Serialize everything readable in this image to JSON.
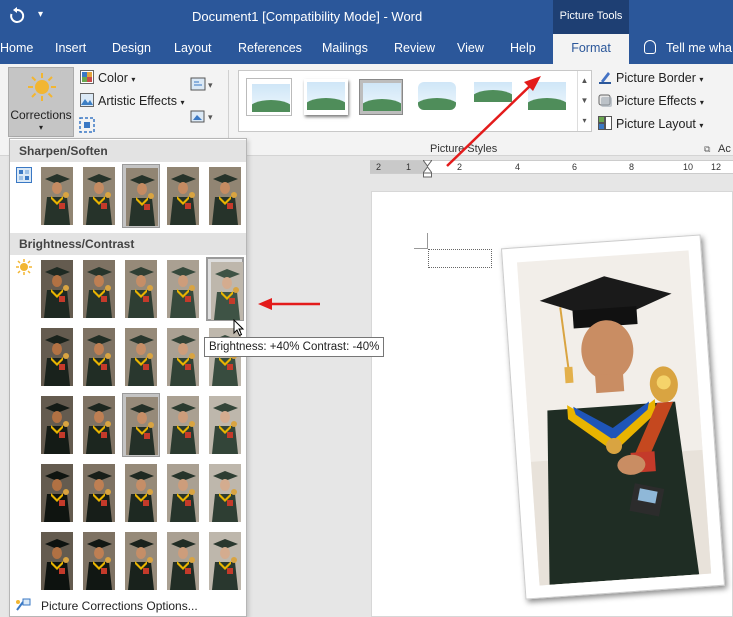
{
  "titlebar": {
    "quick_access_more": "▾",
    "document_title": "Document1 [Compatibility Mode]  -  Word",
    "contextual_tab_group": "Picture Tools"
  },
  "tabs": [
    {
      "label": "Home"
    },
    {
      "label": "Insert"
    },
    {
      "label": "Design"
    },
    {
      "label": "Layout"
    },
    {
      "label": "References"
    },
    {
      "label": "Mailings"
    },
    {
      "label": "Review"
    },
    {
      "label": "View"
    },
    {
      "label": "Help"
    },
    {
      "label": "Format",
      "active": true
    }
  ],
  "tell_me": "Tell me wha",
  "ribbon": {
    "corrections_label": "Corrections",
    "dropdown_caret": "▾",
    "color_label": "Color",
    "artistic_effects_label": "Artistic Effects",
    "picture_border_label": "Picture Border",
    "picture_effects_label": "Picture Effects",
    "picture_layout_label": "Picture Layout",
    "picture_styles_group": "Picture Styles",
    "next_group_label": "Ac",
    "dialog_launcher": "⧉"
  },
  "ruler": {
    "numbers": [
      "2",
      "1",
      "2",
      "4",
      "6",
      "8",
      "10",
      "12"
    ]
  },
  "gallery": {
    "sharpen_header": "Sharpen/Soften",
    "brightness_header": "Brightness/Contrast",
    "options_label": "Picture Corrections Options...",
    "sharpen_selected_index": 2,
    "brightness_selected_row": 2,
    "brightness_selected_col": 2,
    "hover_row": 0,
    "hover_col": 4
  },
  "tooltip": "Brightness: +40% Contrast: -40%",
  "colors": {
    "title_bar": "#2b579a",
    "context_tab": "#1e3f73",
    "ribbon_bg": "#f3f3f3",
    "arrow_red": "#e31b1b",
    "gown": "#1f2d24",
    "trophy_gold": "#d9a441"
  },
  "icons": [
    "undo-icon",
    "sun-icon",
    "color-icon",
    "artistic-effects-icon",
    "compress-icon",
    "change-picture-icon",
    "reset-picture-icon",
    "picture-border-icon",
    "picture-effects-icon",
    "picture-layout-icon",
    "lightbulb-icon",
    "sharpen-icon",
    "brightness-icon",
    "corrections-options-icon"
  ]
}
